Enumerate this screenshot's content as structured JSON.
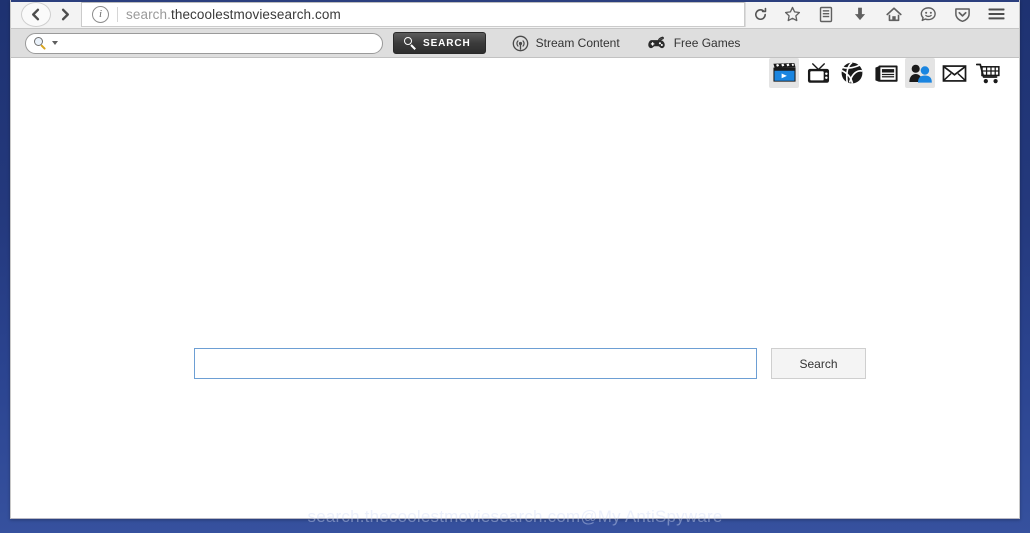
{
  "browser": {
    "nav": {
      "back_label": "Back",
      "forward_label": "Forward",
      "identity_label": "i",
      "url_prefix": "search.",
      "url_domain": "thecoolestmoviesearch.com",
      "url_full": "search.thecoolestmoviesearch.com",
      "reload_label": "Reload",
      "icons": [
        {
          "name": "bookmark-star-icon",
          "label": "Bookmark this page"
        },
        {
          "name": "library-icon",
          "label": "Show your library"
        },
        {
          "name": "download-icon",
          "label": "Downloads"
        },
        {
          "name": "home-icon",
          "label": "Home"
        },
        {
          "name": "sync-smiley-icon",
          "label": "Sync"
        },
        {
          "name": "pocket-shield-icon",
          "label": "Save to Pocket"
        },
        {
          "name": "hamburger-menu-icon",
          "label": "Open menu"
        }
      ]
    }
  },
  "ext_toolbar": {
    "search_placeholder": "",
    "search_value": "",
    "search_button_label": "SEARCH",
    "links": [
      {
        "icon": "stream-antenna-icon",
        "label": "Stream Content"
      },
      {
        "icon": "gamepad-icon",
        "label": "Free Games"
      }
    ]
  },
  "page": {
    "categories": [
      {
        "name": "movies-clapperboard-icon",
        "label": "Movies",
        "active": true
      },
      {
        "name": "tv-icon",
        "label": "TV",
        "active": false
      },
      {
        "name": "sports-basketball-icon",
        "label": "Sports",
        "active": false
      },
      {
        "name": "news-newspaper-icon",
        "label": "News",
        "active": false
      },
      {
        "name": "social-people-icon",
        "label": "Social",
        "active": true
      },
      {
        "name": "mail-envelope-icon",
        "label": "Mail",
        "active": false
      },
      {
        "name": "shopping-cart-icon",
        "label": "Shopping",
        "active": false
      }
    ],
    "search_value": "",
    "search_placeholder": "",
    "search_button_label": "Search",
    "watermark": "search.thecoolestmoviesearch.com@My AntiSpyware"
  },
  "colors": {
    "desktop_blue": "#24397d",
    "accent_blue": "#1a7fd4",
    "input_border_blue": "#6d9fd4",
    "toolbar_gray": "#dedede"
  }
}
